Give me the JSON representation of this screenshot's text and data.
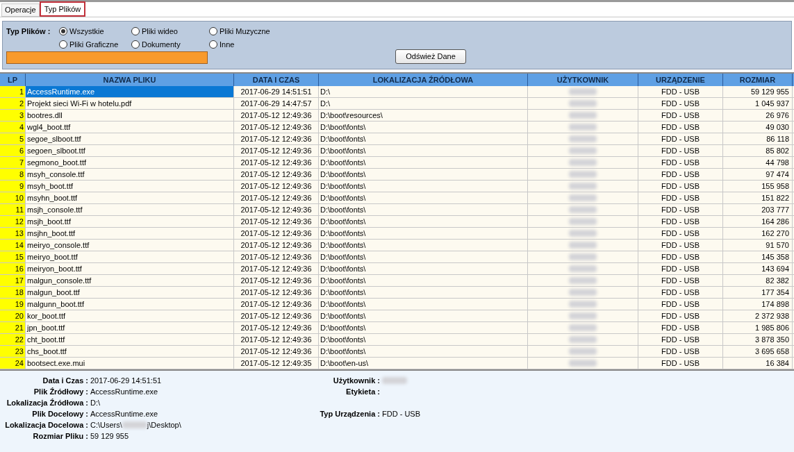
{
  "tabs": [
    {
      "label": "Operacje",
      "selected": false
    },
    {
      "label": "Typ Plików",
      "selected": true
    }
  ],
  "filter": {
    "label": "Typ Plików :",
    "options": [
      {
        "label": "Wszystkie",
        "selected": true
      },
      {
        "label": "Pliki Graficzne",
        "selected": false
      },
      {
        "label": "Pliki wideo",
        "selected": false
      },
      {
        "label": "Dokumenty",
        "selected": false
      },
      {
        "label": "Pliki Muzyczne",
        "selected": false
      },
      {
        "label": "Inne",
        "selected": false
      }
    ],
    "refresh_button": "Odśwież Dane"
  },
  "table": {
    "columns": [
      "LP",
      "NAZWA PLIKU",
      "DATA I CZAS",
      "LOKALIZACJA ŹRÓDŁOWA",
      "UŻYTKOWNIK",
      "URZĄDZENIE",
      "ROZMIAR"
    ],
    "rows": [
      {
        "lp": "1",
        "name": "AccessRuntime.exe",
        "date": "2017-06-29 14:51:51",
        "location": "D:\\",
        "device": "FDD - USB",
        "size": "59 129 955",
        "selected": true
      },
      {
        "lp": "2",
        "name": "Projekt sieci Wi-Fi w hotelu.pdf",
        "date": "2017-06-29 14:47:57",
        "location": "D:\\",
        "device": "FDD - USB",
        "size": "1 045 937",
        "selected": false
      },
      {
        "lp": "3",
        "name": "bootres.dll",
        "date": "2017-05-12 12:49:36",
        "location": "D:\\boot\\resources\\",
        "device": "FDD - USB",
        "size": "26 976",
        "selected": false
      },
      {
        "lp": "4",
        "name": "wgl4_boot.ttf",
        "date": "2017-05-12 12:49:36",
        "location": "D:\\boot\\fonts\\",
        "device": "FDD - USB",
        "size": "49 030",
        "selected": false
      },
      {
        "lp": "5",
        "name": "segoe_slboot.ttf",
        "date": "2017-05-12 12:49:36",
        "location": "D:\\boot\\fonts\\",
        "device": "FDD - USB",
        "size": "86 118",
        "selected": false
      },
      {
        "lp": "6",
        "name": "segoen_slboot.ttf",
        "date": "2017-05-12 12:49:36",
        "location": "D:\\boot\\fonts\\",
        "device": "FDD - USB",
        "size": "85 802",
        "selected": false
      },
      {
        "lp": "7",
        "name": "segmono_boot.ttf",
        "date": "2017-05-12 12:49:36",
        "location": "D:\\boot\\fonts\\",
        "device": "FDD - USB",
        "size": "44 798",
        "selected": false
      },
      {
        "lp": "8",
        "name": "msyh_console.ttf",
        "date": "2017-05-12 12:49:36",
        "location": "D:\\boot\\fonts\\",
        "device": "FDD - USB",
        "size": "97 474",
        "selected": false
      },
      {
        "lp": "9",
        "name": "msyh_boot.ttf",
        "date": "2017-05-12 12:49:36",
        "location": "D:\\boot\\fonts\\",
        "device": "FDD - USB",
        "size": "155 958",
        "selected": false
      },
      {
        "lp": "10",
        "name": "msyhn_boot.ttf",
        "date": "2017-05-12 12:49:36",
        "location": "D:\\boot\\fonts\\",
        "device": "FDD - USB",
        "size": "151 822",
        "selected": false
      },
      {
        "lp": "11",
        "name": "msjh_console.ttf",
        "date": "2017-05-12 12:49:36",
        "location": "D:\\boot\\fonts\\",
        "device": "FDD - USB",
        "size": "203 777",
        "selected": false
      },
      {
        "lp": "12",
        "name": "msjh_boot.ttf",
        "date": "2017-05-12 12:49:36",
        "location": "D:\\boot\\fonts\\",
        "device": "FDD - USB",
        "size": "164 286",
        "selected": false
      },
      {
        "lp": "13",
        "name": "msjhn_boot.ttf",
        "date": "2017-05-12 12:49:36",
        "location": "D:\\boot\\fonts\\",
        "device": "FDD - USB",
        "size": "162 270",
        "selected": false
      },
      {
        "lp": "14",
        "name": "meiryo_console.ttf",
        "date": "2017-05-12 12:49:36",
        "location": "D:\\boot\\fonts\\",
        "device": "FDD - USB",
        "size": "91 570",
        "selected": false
      },
      {
        "lp": "15",
        "name": "meiryo_boot.ttf",
        "date": "2017-05-12 12:49:36",
        "location": "D:\\boot\\fonts\\",
        "device": "FDD - USB",
        "size": "145 358",
        "selected": false
      },
      {
        "lp": "16",
        "name": "meiryon_boot.ttf",
        "date": "2017-05-12 12:49:36",
        "location": "D:\\boot\\fonts\\",
        "device": "FDD - USB",
        "size": "143 694",
        "selected": false
      },
      {
        "lp": "17",
        "name": "malgun_console.ttf",
        "date": "2017-05-12 12:49:36",
        "location": "D:\\boot\\fonts\\",
        "device": "FDD - USB",
        "size": "82 382",
        "selected": false
      },
      {
        "lp": "18",
        "name": "malgun_boot.ttf",
        "date": "2017-05-12 12:49:36",
        "location": "D:\\boot\\fonts\\",
        "device": "FDD - USB",
        "size": "177 354",
        "selected": false
      },
      {
        "lp": "19",
        "name": "malgunn_boot.ttf",
        "date": "2017-05-12 12:49:36",
        "location": "D:\\boot\\fonts\\",
        "device": "FDD - USB",
        "size": "174 898",
        "selected": false
      },
      {
        "lp": "20",
        "name": "kor_boot.ttf",
        "date": "2017-05-12 12:49:36",
        "location": "D:\\boot\\fonts\\",
        "device": "FDD - USB",
        "size": "2 372 938",
        "selected": false
      },
      {
        "lp": "21",
        "name": "jpn_boot.ttf",
        "date": "2017-05-12 12:49:36",
        "location": "D:\\boot\\fonts\\",
        "device": "FDD - USB",
        "size": "1 985 806",
        "selected": false
      },
      {
        "lp": "22",
        "name": "cht_boot.ttf",
        "date": "2017-05-12 12:49:36",
        "location": "D:\\boot\\fonts\\",
        "device": "FDD - USB",
        "size": "3 878 350",
        "selected": false
      },
      {
        "lp": "23",
        "name": "chs_boot.ttf",
        "date": "2017-05-12 12:49:36",
        "location": "D:\\boot\\fonts\\",
        "device": "FDD - USB",
        "size": "3 695 658",
        "selected": false
      },
      {
        "lp": "24",
        "name": "bootsect.exe.mui",
        "date": "2017-05-12 12:49:35",
        "location": "D:\\boot\\en-us\\",
        "device": "FDD - USB",
        "size": "16 384",
        "selected": false
      }
    ]
  },
  "details": {
    "rows": [
      {
        "left": {
          "label": "Data i Czas :",
          "parts": [
            {
              "kind": "text",
              "text": "2017-06-29 14:51:51"
            }
          ]
        },
        "right": {
          "label": "Użytkownik :",
          "parts": [
            {
              "kind": "blurred"
            }
          ]
        }
      },
      {
        "left": {
          "label": "Plik Źródłowy :",
          "parts": [
            {
              "kind": "text",
              "text": "AccessRuntime.exe"
            }
          ]
        },
        "right": {
          "label": "Etykieta :"
        }
      },
      {
        "left": {
          "label": "Lokalizacja Źródłowa :",
          "parts": [
            {
              "kind": "text",
              "text": "D:\\"
            }
          ]
        }
      },
      {
        "left": {
          "label": "Plik Docelowy :",
          "parts": [
            {
              "kind": "text",
              "text": "AccessRuntime.exe"
            }
          ]
        },
        "right": {
          "label": "Typ Urządzenia :",
          "parts": [
            {
              "kind": "text",
              "text": "FDD - USB"
            }
          ]
        }
      },
      {
        "left": {
          "label": "Lokalizacja Docelowa :",
          "parts": [
            {
              "kind": "text",
              "text": "C:\\Users\\"
            },
            {
              "kind": "blurred"
            },
            {
              "kind": "text",
              "text": "j\\Desktop\\"
            }
          ]
        }
      },
      {
        "left": {
          "label": "Rozmiar Pliku :",
          "parts": [
            {
              "kind": "text",
              "text": "59 129 955"
            }
          ]
        }
      }
    ]
  }
}
